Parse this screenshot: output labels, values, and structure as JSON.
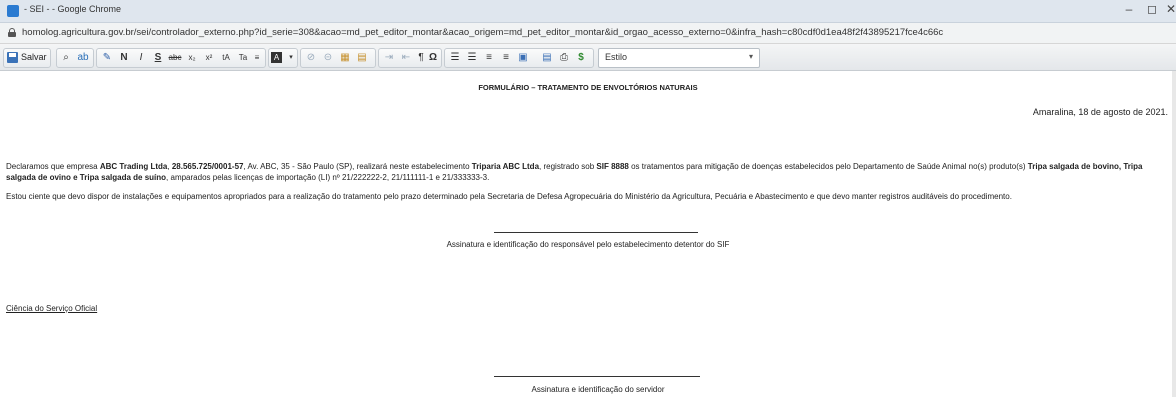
{
  "window": {
    "title": "- SEI - - Google Chrome",
    "controls": [
      "–",
      "◻",
      "✕"
    ]
  },
  "address": {
    "url": "homolog.agricultura.gov.br/sei/controlador_externo.php?id_serie=308&acao=md_pet_editor_montar&acao_origem=md_pet_editor_montar&id_orgao_acesso_externo=0&infra_hash=c80cdf0d1ea48f2f43895217fce4c66c"
  },
  "toolbar": {
    "save_label": "Salvar",
    "style_label": "Estilo",
    "buttons": [
      "find",
      "replace",
      "highlight",
      "bold",
      "italic",
      "underline",
      "strike",
      "subscript",
      "superscript",
      "uppercase",
      "lowercase",
      "paragraph",
      "color",
      "link",
      "unlink",
      "image",
      "table",
      "indent",
      "outdent",
      "special-char",
      "omega",
      "numbered-list",
      "bullet-list",
      "align-left",
      "align-center",
      "picture",
      "print",
      "spell",
      "money"
    ]
  },
  "document": {
    "title": "FORMULÁRIO – TRATAMENTO DE ENVOLTÓRIOS NATURAIS",
    "date": "Amaralina, 18 de agosto de 2021.",
    "declaration": {
      "p1": "Declaramos que empresa ",
      "company": "ABC Trading Ltda",
      "p2": ", ",
      "cnpj": "28.565.725/0001-57",
      "p3": ", Av. ABC, 35 - São Paulo (SP), realizará neste estabelecimento ",
      "establishment": "Triparia ABC Ltda",
      "p4": ", registrado sob ",
      "sif": "SIF 8888",
      "p5": " os tratamentos para mitigação de doenças estabelecidos pelo Departamento de Saúde Animal no(s) produto(s) ",
      "products": "Tripa salgada de bovino, Tripa salgada de ovino e Tripa salgada de suíno",
      "p6": ", amparados pelas licenças de importação (LI) nº 21/222222-2, 21/111111-1 e 21/333333-3."
    },
    "awareness": "Estou ciente que devo dispor de instalações e equipamentos apropriados para a realização do tratamento pelo prazo determinado pela Secretaria de Defesa Agropecuária do Ministério da Agricultura, Pecuária e Abastecimento e que devo manter registros auditáveis do procedimento.",
    "signature1": "Assinatura e identificação do responsável pelo estabelecimento detentor do SIF",
    "official_section": "Ciência do Serviço Oficial",
    "signature2": "Assinatura e identificação do servidor"
  }
}
